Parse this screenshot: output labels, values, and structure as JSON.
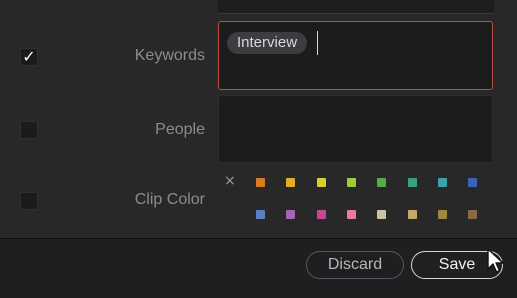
{
  "rows": {
    "keywords": {
      "label": "Keywords",
      "checked": true,
      "check_glyph": "✓"
    },
    "people": {
      "label": "People",
      "checked": false
    },
    "clip_color": {
      "label": "Clip Color",
      "checked": false
    }
  },
  "keywords_field": {
    "tags": [
      "Interview"
    ]
  },
  "clip_color": {
    "clear_glyph": "×",
    "swatches_row1": [
      "#d97b22",
      "#e3ad24",
      "#d5d02c",
      "#9ccd33",
      "#58ab45",
      "#3aa37a",
      "#3aa3a8",
      "#3b63b5"
    ],
    "swatches_row2": [
      "#5b7fc4",
      "#a664b3",
      "#c7478f",
      "#e67aa3",
      "#c9c2a8",
      "#c7a86b",
      "#9d8a3c",
      "#8a6a44"
    ]
  },
  "footer": {
    "discard_label": "Discard",
    "save_label": "Save"
  },
  "colors": {
    "accent_border": "#c04a46"
  }
}
